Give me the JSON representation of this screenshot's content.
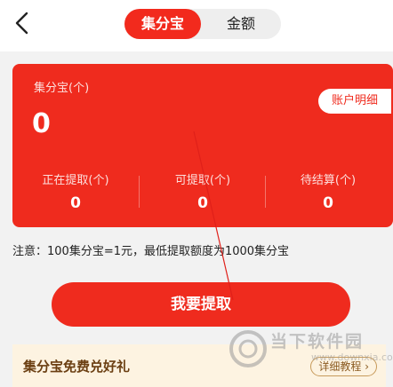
{
  "header": {
    "back_icon": "chevron-left-icon",
    "tabs": [
      {
        "label": "集分宝",
        "active": true
      },
      {
        "label": "金额",
        "active": false
      }
    ]
  },
  "card": {
    "label": "集分宝(个)",
    "value": "0",
    "detail_button": "账户明细",
    "stats": [
      {
        "label": "正在提取(个)",
        "value": "0"
      },
      {
        "label": "可提取(个)",
        "value": "0"
      },
      {
        "label": "待结算(个)",
        "value": "0"
      }
    ],
    "color": "#ef2b1e"
  },
  "notice": "注意：100集分宝=1元，最低提取额度为1000集分宝",
  "withdraw_button": "我要提取",
  "banner": {
    "title": "集分宝免费兑好礼",
    "tutorial_button": "详细教程 ›",
    "background": "#fdf3e1"
  },
  "watermark": {
    "text": "当下软件园",
    "url": "www.downxia.com"
  }
}
